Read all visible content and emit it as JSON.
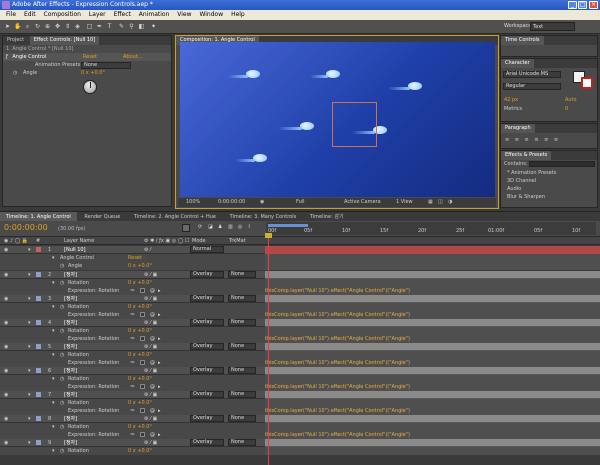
{
  "app": {
    "title": "Adobe After Effects - Expression Controls.aep *"
  },
  "menu": [
    "File",
    "Edit",
    "Composition",
    "Layer",
    "Effect",
    "Animation",
    "View",
    "Window",
    "Help"
  ],
  "workspace": {
    "label": "Workspace:",
    "value": "Text"
  },
  "project_panel": {
    "tabs": [
      "Project",
      "Effect Controls: [Null 10]"
    ],
    "subtitle": "1. Angle Control * [Null 10]",
    "effect_name": "Angle Control",
    "reset": "Reset",
    "about": "About...",
    "preset_label": "Animation Presets:",
    "preset_value": "None",
    "angle_label": "Angle",
    "angle_value": "0 x +0.0°"
  },
  "viewer": {
    "tab": "Composition: 1. Angle Control",
    "zoom": "100%",
    "timecode": "0:00:00:00",
    "resolution": "Full",
    "camera": "Active Camera",
    "views": "1 View"
  },
  "right_panels": {
    "time_controls": "Time Controls",
    "character": "Character",
    "font": "Arial Unicode MS",
    "style": "Regular",
    "font_size": "42 px",
    "leading": "Auto",
    "tracking": "Metrics",
    "kerning": "0",
    "paragraph": "Paragraph",
    "effects_presets": "Effects & Presets",
    "contains_label": "Contains:",
    "effect_list": [
      "* Animation Presets",
      "3D Channel",
      "Audio",
      "Blur & Sharpen"
    ]
  },
  "timeline_tabs": [
    "Timeline: 1. Angle Control",
    "Render Queue",
    "Timeline: 2. Angle Control + Hue",
    "Timeline: 3. Many Controls",
    "Timeline: 감기"
  ],
  "timeline": {
    "timecode": "0:00:00:00",
    "fps": "(30.00 fps)",
    "col_layer_name": "Layer Name",
    "col_mode": "Mode",
    "col_trkmat": "TrkMat",
    "ruler": [
      "00f",
      "05f",
      "10f",
      "15f",
      "20f",
      "25f",
      "01:00f",
      "05f",
      "10f"
    ]
  },
  "layers": [
    {
      "num": "1",
      "name": "[Null 10]",
      "mode": "Normal",
      "trk": "",
      "effect_row": "Angle Control",
      "reset": "Reset",
      "prop": "Angle",
      "value": "0 x +0.0°",
      "expr": ""
    },
    {
      "num": "2",
      "name": "[정자]",
      "mode": "Overlay",
      "trk": "None",
      "prop": "Rotation",
      "value": "0 x +0.0°",
      "expr_label": "Expression: Rotation",
      "expr": "thisComp.layer(\"Null 10\").effect(\"Angle Control\")(\"Angle\")"
    },
    {
      "num": "3",
      "name": "[정자]",
      "mode": "Overlay",
      "trk": "None",
      "prop": "Rotation",
      "value": "0 x +0.0°",
      "expr_label": "Expression: Rotation",
      "expr": "thisComp.layer(\"Null 10\").effect(\"Angle Control\")(\"Angle\")"
    },
    {
      "num": "4",
      "name": "[정자]",
      "mode": "Overlay",
      "trk": "None",
      "prop": "Rotation",
      "value": "0 x +0.0°",
      "expr_label": "Expression: Rotation",
      "expr": "thisComp.layer(\"Null 10\").effect(\"Angle Control\")(\"Angle\")"
    },
    {
      "num": "5",
      "name": "[정자]",
      "mode": "Overlay",
      "trk": "None",
      "prop": "Rotation",
      "value": "0 x +0.0°",
      "expr_label": "Expression: Rotation",
      "expr": "thisComp.layer(\"Null 10\").effect(\"Angle Control\")(\"Angle\")"
    },
    {
      "num": "6",
      "name": "[정자]",
      "mode": "Overlay",
      "trk": "None",
      "prop": "Rotation",
      "value": "0 x +0.0°",
      "expr_label": "Expression: Rotation",
      "expr": "thisComp.layer(\"Null 10\").effect(\"Angle Control\")(\"Angle\")"
    },
    {
      "num": "7",
      "name": "[정자]",
      "mode": "Overlay",
      "trk": "None",
      "prop": "Rotation",
      "value": "0 x +0.0°",
      "expr_label": "Expression: Rotation",
      "expr": "thisComp.layer(\"Null 10\").effect(\"Angle Control\")(\"Angle\")"
    },
    {
      "num": "8",
      "name": "[정자]",
      "mode": "Overlay",
      "trk": "None",
      "prop": "Rotation",
      "value": "0 x +0.0°",
      "expr_label": "Expression: Rotation",
      "expr": "thisComp.layer(\"Null 10\").effect(\"Angle Control\")(\"Angle\")"
    },
    {
      "num": "9",
      "name": "[정자]",
      "mode": "Overlay",
      "trk": "None",
      "prop": "Rotation",
      "value": "0 x +0.0°",
      "expr_label": "",
      "expr": ""
    }
  ],
  "colors": {
    "accent": "#e0a020",
    "null_bar": "#b04848",
    "layer_bar": "#8a8a8a",
    "viewer_bg": "#2f4fc0"
  }
}
